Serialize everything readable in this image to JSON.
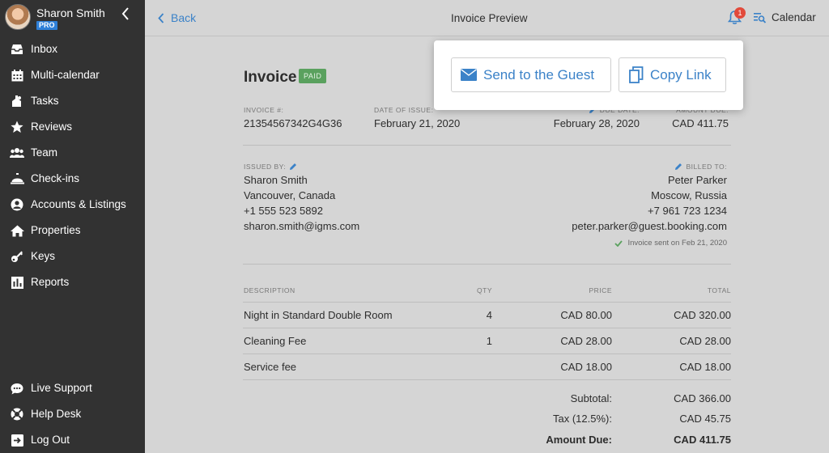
{
  "sidebar": {
    "user_name": "Sharon Smith",
    "user_badge": "PRO",
    "items": [
      {
        "label": "Inbox",
        "icon": "inbox-icon"
      },
      {
        "label": "Multi-calendar",
        "icon": "calendar-grid-icon"
      },
      {
        "label": "Tasks",
        "icon": "tasks-icon"
      },
      {
        "label": "Reviews",
        "icon": "star-icon"
      },
      {
        "label": "Team",
        "icon": "team-icon"
      },
      {
        "label": "Check-ins",
        "icon": "bell-service-icon"
      },
      {
        "label": "Accounts & Listings",
        "icon": "account-icon"
      },
      {
        "label": "Properties",
        "icon": "home-icon"
      },
      {
        "label": "Keys",
        "icon": "key-icon"
      },
      {
        "label": "Reports",
        "icon": "chart-icon"
      }
    ],
    "bottom_items": [
      {
        "label": "Live Support",
        "icon": "chat-icon"
      },
      {
        "label": "Help Desk",
        "icon": "lifebuoy-icon"
      },
      {
        "label": "Log Out",
        "icon": "logout-icon"
      }
    ]
  },
  "topbar": {
    "back_label": "Back",
    "title": "Invoice Preview",
    "notification_count": "1",
    "calendar_label": "Calendar"
  },
  "share": {
    "send_label": "Send to the Guest",
    "copy_label": "Copy Link"
  },
  "invoice": {
    "title": "Invoice",
    "status": "PAID",
    "number_label": "INVOICE #:",
    "number": "21354567342G4G36",
    "issue_date_label": "DATE OF ISSUE:",
    "issue_date": "February 21, 2020",
    "due_date_label": "DUE DATE:",
    "due_date": "February 28, 2020",
    "amount_due_label": "AMOUNT DUE:",
    "amount_due": "CAD 411.75",
    "issued_by_label": "ISSUED BY:",
    "issued_by": [
      "Sharon Smith",
      "Vancouver, Canada",
      "+1 555 523 5892",
      "sharon.smith@igms.com"
    ],
    "billed_to_label": "BILLED TO:",
    "billed_to": [
      "Peter Parker",
      "Moscow, Russia",
      "+7 961 723 1234",
      "peter.parker@guest.booking.com"
    ],
    "sent_note": "Invoice sent on Feb 21, 2020",
    "columns": {
      "description": "DESCRIPTION",
      "qty": "QTY",
      "price": "PRICE",
      "total": "TOTAL"
    },
    "items": [
      {
        "description": "Night in Standard Double Room",
        "qty": "4",
        "price": "CAD 80.00",
        "total": "CAD 320.00"
      },
      {
        "description": "Cleaning Fee",
        "qty": "1",
        "price": "CAD 28.00",
        "total": "CAD 28.00"
      },
      {
        "description": "Service fee",
        "qty": "",
        "price": "CAD 18.00",
        "total": "CAD 18.00"
      }
    ],
    "subtotal_label": "Subtotal:",
    "subtotal": "CAD 366.00",
    "tax_label": "Tax (12.5%):",
    "tax": "CAD 45.75",
    "amount_due_total_label": "Amount Due:",
    "amount_due_total": "CAD 411.75"
  },
  "colors": {
    "accent": "#3b82c8",
    "sidebar": "#323232",
    "paid": "#5aa15e",
    "badge": "#e24a3b"
  }
}
